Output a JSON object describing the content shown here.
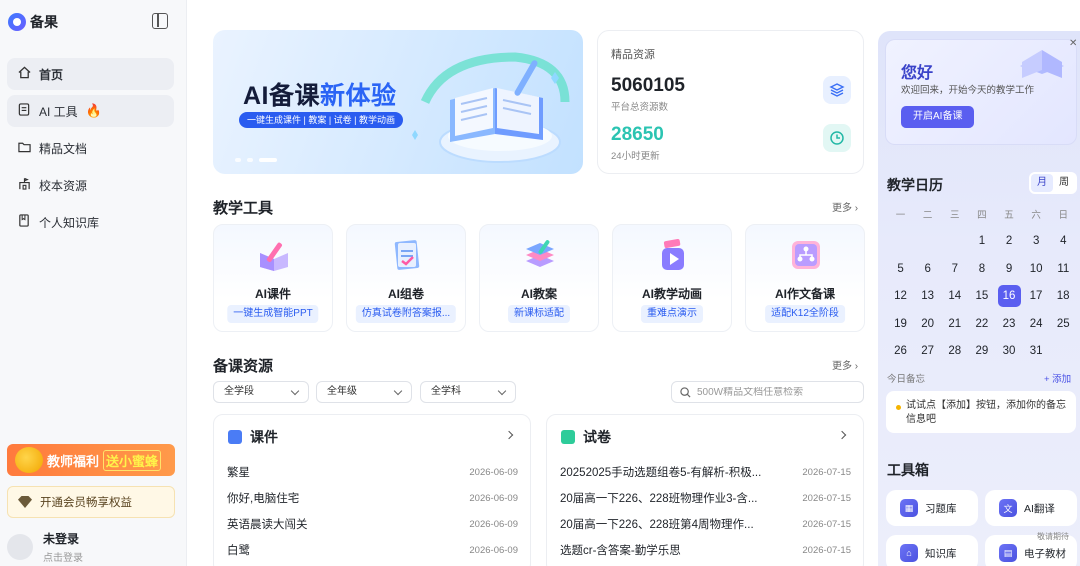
{
  "app": {
    "logo_text": "备果"
  },
  "sidebar": {
    "items": [
      {
        "label": "首页",
        "icon": "home-icon"
      },
      {
        "label": "AI 工具",
        "icon": "document-icon",
        "badge": "🔥"
      },
      {
        "label": "精品文档",
        "icon": "folder-icon"
      },
      {
        "label": "校本资源",
        "icon": "school-icon"
      },
      {
        "label": "个人知识库",
        "icon": "book-icon"
      }
    ],
    "promo": {
      "text": "教师福利",
      "highlight": "送小蜜蜂"
    },
    "vip_label": "开通会员畅享权益",
    "user": {
      "name": "未登录",
      "sub": "点击登录"
    }
  },
  "banner": {
    "title_a": "AI备课",
    "title_b": "新体验",
    "subtitle": "一键生成课件 | 教案 | 试卷 | 教学动画"
  },
  "resources": {
    "title": "精品资源",
    "total": "5060105",
    "total_label": "平台总资源数",
    "daily": "28650",
    "daily_label": "24小时更新"
  },
  "tools_section": {
    "title": "教学工具",
    "more": "更多"
  },
  "tools": [
    {
      "name": "AI课件",
      "tag": "一键生成智能PPT"
    },
    {
      "name": "AI组卷",
      "tag": "仿真试卷附答案报..."
    },
    {
      "name": "AI教案",
      "tag": "新课标适配"
    },
    {
      "name": "AI教学动画",
      "tag": "重难点演示"
    },
    {
      "name": "AI作文备课",
      "tag": "适配K12全阶段"
    }
  ],
  "resources_section": {
    "title": "备课资源",
    "more": "更多"
  },
  "filters": {
    "stage": "全学段",
    "grade": "全年级",
    "subject": "全学科"
  },
  "search": {
    "placeholder": "500W精品文档任意检索"
  },
  "courseware": {
    "title": "课件",
    "rows": [
      {
        "title": "繁星",
        "date": "2026-06-09"
      },
      {
        "title": "你好,电脑住宅",
        "date": "2026-06-09"
      },
      {
        "title": "英语晨读大闯关",
        "date": "2026-06-09"
      },
      {
        "title": "白鹭",
        "date": "2026-06-09"
      }
    ]
  },
  "papers": {
    "title": "试卷",
    "rows": [
      {
        "title": "20252025手动选题组卷5-有解析-积极...",
        "date": "2026-07-15"
      },
      {
        "title": "20届高一下226、228班物理作业3-含...",
        "date": "2026-07-15"
      },
      {
        "title": "20届高一下226、228班第4周物理作...",
        "date": "2026-07-15"
      },
      {
        "title": "选题cr-含答案-勤学乐思",
        "date": "2026-07-15"
      }
    ]
  },
  "welcome": {
    "hello": "您好",
    "sub": "欢迎回来，开始今天的教学工作",
    "button": "开启AI备课"
  },
  "calendar": {
    "title": "教学日历",
    "month_label": "月",
    "week_label": "周",
    "weekdays": [
      "一",
      "二",
      "三",
      "四",
      "五",
      "六",
      "日"
    ],
    "weeks": [
      [
        "",
        "",
        "",
        "1",
        "2",
        "3",
        "4"
      ],
      [
        "5",
        "6",
        "7",
        "8",
        "9",
        "10",
        "11"
      ],
      [
        "12",
        "13",
        "14",
        "15",
        "16",
        "17",
        "18"
      ],
      [
        "19",
        "20",
        "21",
        "22",
        "23",
        "24",
        "25"
      ],
      [
        "26",
        "27",
        "28",
        "29",
        "30",
        "31",
        ""
      ]
    ],
    "today": "16"
  },
  "memo": {
    "label": "今日备忘",
    "add": "+ 添加",
    "text": "试试点【添加】按钮，添加你的备忘信息吧"
  },
  "toolbox": {
    "title": "工具箱",
    "items": [
      {
        "label": "习题库",
        "icon": "exercise-icon"
      },
      {
        "label": "AI翻译",
        "icon": "translate-icon"
      },
      {
        "label": "知识库",
        "icon": "knowledge-icon"
      },
      {
        "label": "电子教材",
        "icon": "ebook-icon",
        "badge": "敬请期待"
      }
    ]
  }
}
